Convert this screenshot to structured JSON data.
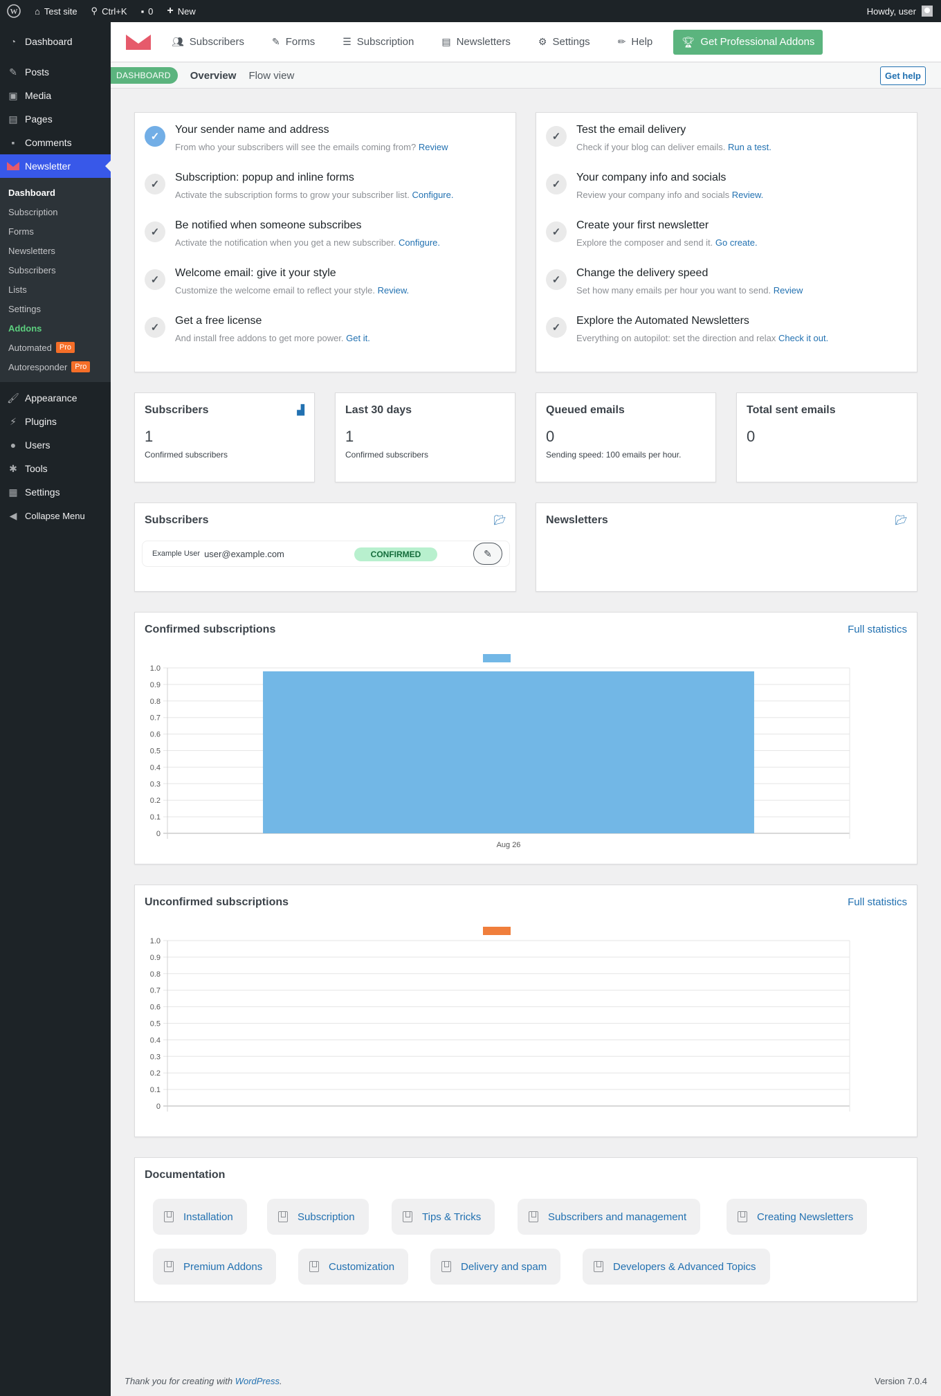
{
  "admin_bar": {
    "site_name": "Test site",
    "search_shortcut": "Ctrl+K",
    "comments_count": "0",
    "new_label": "New",
    "howdy": "Howdy, user"
  },
  "sidebar": {
    "items_top": [
      {
        "label": "Dashboard",
        "icon": "dashboard-icon"
      },
      {
        "label": "Posts",
        "icon": "pin-icon"
      },
      {
        "label": "Media",
        "icon": "media-icon"
      },
      {
        "label": "Pages",
        "icon": "pages-icon"
      },
      {
        "label": "Comments",
        "icon": "comment-icon"
      },
      {
        "label": "Newsletter",
        "icon": "newsletter-icon"
      }
    ],
    "submenu": [
      {
        "label": "Dashboard"
      },
      {
        "label": "Subscription"
      },
      {
        "label": "Forms"
      },
      {
        "label": "Newsletters"
      },
      {
        "label": "Subscribers"
      },
      {
        "label": "Lists"
      },
      {
        "label": "Settings"
      },
      {
        "label": "Addons"
      },
      {
        "label": "Automated",
        "badge": "Pro"
      },
      {
        "label": "Autoresponder",
        "badge": "Pro"
      }
    ],
    "items_bottom": [
      {
        "label": "Appearance",
        "icon": "brush-icon"
      },
      {
        "label": "Plugins",
        "icon": "plugin-icon"
      },
      {
        "label": "Users",
        "icon": "user-icon"
      },
      {
        "label": "Tools",
        "icon": "wrench-icon"
      },
      {
        "label": "Settings",
        "icon": "settings-icon"
      },
      {
        "label": "Collapse Menu",
        "icon": "collapse-icon"
      }
    ]
  },
  "topnav": {
    "items": [
      "Subscribers",
      "Forms",
      "Subscription",
      "Newsletters",
      "Settings",
      "Help"
    ],
    "pro_button": "Get Professional Addons"
  },
  "subnav": {
    "pill": "DASHBOARD",
    "tabs": [
      "Overview",
      "Flow view"
    ],
    "get_help": "Get help"
  },
  "checklist_left": [
    {
      "title": "Your sender name and address",
      "desc": "From who your subscribers will see the emails coming from?",
      "link": "Review",
      "done": true
    },
    {
      "title": "Subscription: popup and inline forms",
      "desc": "Activate the subscription forms to grow your subscriber list.",
      "link": "Configure.",
      "done": false
    },
    {
      "title": "Be notified when someone subscribes",
      "desc": "Activate the notification when you get a new subscriber.",
      "link": "Configure.",
      "done": false
    },
    {
      "title": "Welcome email: give it your style",
      "desc": "Customize the welcome email to reflect your style.",
      "link": "Review.",
      "done": false
    },
    {
      "title": "Get a free license",
      "desc": "And install free addons to get more power.",
      "link": "Get it.",
      "done": false
    }
  ],
  "checklist_right": [
    {
      "title": "Test the email delivery",
      "desc": "Check if your blog can deliver emails.",
      "link": "Run a test.",
      "done": false
    },
    {
      "title": "Your company info and socials",
      "desc": "Review your company info and socials",
      "link": "Review.",
      "done": false
    },
    {
      "title": "Create your first newsletter",
      "desc": "Explore the composer and send it.",
      "link": "Go create.",
      "done": false
    },
    {
      "title": "Change the delivery speed",
      "desc": "Set how many emails per hour you want to send.",
      "link": "Review",
      "done": false
    },
    {
      "title": "Explore the Automated Newsletters",
      "desc": "Everything on autopilot: set the direction and relax",
      "link": "Check it out.",
      "done": false
    }
  ],
  "stats": [
    {
      "title": "Subscribers",
      "value": "1",
      "sub": "Confirmed subscribers"
    },
    {
      "title": "Last 30 days",
      "value": "1",
      "sub": "Confirmed subscribers"
    },
    {
      "title": "Queued emails",
      "value": "0",
      "sub": "Sending speed: 100 emails per hour."
    },
    {
      "title": "Total sent emails",
      "value": "0",
      "sub": ""
    }
  ],
  "subscribers_panel": {
    "title": "Subscribers",
    "row": {
      "name": "Example User",
      "email": "user@example.com",
      "status": "CONFIRMED"
    }
  },
  "newsletters_panel": {
    "title": "Newsletters"
  },
  "colors": {
    "confirmed": "#72b7e6",
    "unconfirmed": "#f07e3c",
    "accent": "#2271b1",
    "green": "#5bb47e"
  },
  "chart_data": [
    {
      "type": "bar",
      "title": "Confirmed subscriptions",
      "link": "Full statistics",
      "categories": [
        "Aug 26"
      ],
      "values": [
        1
      ],
      "yticks": [
        "0",
        "0.1",
        "0.2",
        "0.3",
        "0.4",
        "0.5",
        "0.6",
        "0.7",
        "0.8",
        "0.9",
        "1.0"
      ],
      "ylim": [
        0,
        1
      ],
      "color": "#72b7e6"
    },
    {
      "type": "bar",
      "title": "Unconfirmed subscriptions",
      "link": "Full statistics",
      "categories": [],
      "values": [],
      "yticks": [
        "0",
        "0.1",
        "0.2",
        "0.3",
        "0.4",
        "0.5",
        "0.6",
        "0.7",
        "0.8",
        "0.9",
        "1.0"
      ],
      "ylim": [
        0,
        1
      ],
      "color": "#f07e3c"
    }
  ],
  "documentation": {
    "title": "Documentation",
    "links": [
      "Installation",
      "Subscription",
      "Tips & Tricks",
      "Subscribers and management",
      "Creating Newsletters",
      "Premium Addons",
      "Customization",
      "Delivery and spam",
      "Developers & Advanced Topics"
    ]
  },
  "footer": {
    "thanks_prefix": "Thank you for creating with ",
    "thanks_link": "WordPress",
    "thanks_suffix": ".",
    "version": "Version 7.0.4"
  }
}
